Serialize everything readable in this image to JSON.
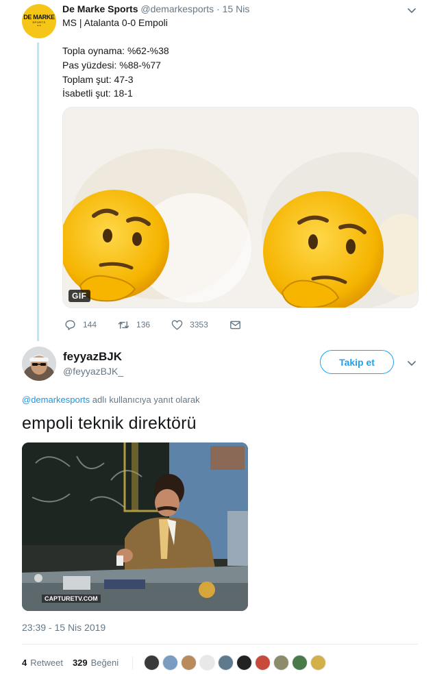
{
  "parent_tweet": {
    "avatar_text_1": "DE MARKE",
    "avatar_text_2": "SPORTS",
    "name": "De Marke Sports",
    "handle": "@demarkesports",
    "separator": "·",
    "date": "15 Nis",
    "lines": [
      "MS | Atalanta 0-0 Empoli",
      "Topla oynama: %62-%38",
      "Pas yüzdesi: %88-%77",
      "Toplam şut: 47-3",
      "İsabetli şut: 18-1"
    ],
    "media_badge": "GIF",
    "replies": "144",
    "retweets": "136",
    "likes": "3353"
  },
  "reply_tweet": {
    "name": "feyyazBJK",
    "handle": "@feyyazBJK_",
    "follow_label": "Takip et",
    "reply_mention": "@demarkesports",
    "reply_suffix": " adlı kullanıcıya yanıt olarak",
    "text": "empoli teknik direktörü",
    "watermark": "CAPTURETV.COM",
    "timestamp": "23:39 - 15 Nis 2019",
    "retweet_count": "4",
    "retweet_label": "Retweet",
    "like_count": "329",
    "like_label": "Beğeni"
  },
  "icons": [
    "chevron-down-icon",
    "reply-icon",
    "retweet-icon",
    "heart-icon",
    "dm-icon"
  ],
  "colors": {
    "accent": "#1da1f2",
    "secondary_text": "#657786",
    "thread_line": "#c9e3ee",
    "brand_yellow": "#f5c518"
  }
}
